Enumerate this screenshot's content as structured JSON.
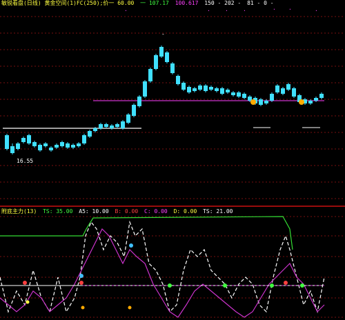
{
  "top_header": {
    "title": "敏锐看盘(日线) 黄金空间(1)FC(250);价一 60.00",
    "items": [
      {
        "text": "一 107.17",
        "color": "#40ff40"
      },
      {
        "text": "100.617",
        "color": "#ff40ff"
      },
      {
        "text": "150 - 202 -",
        "color": "#ffffff"
      },
      {
        "text": "81 - 0 -",
        "color": "#ffffff"
      }
    ]
  },
  "top_chart": {
    "low_label": "16.55",
    "high_label": "-",
    "resistance_color": "#cc33cc",
    "up_color": "#ff3030",
    "down_color": "#40e0ff",
    "baseline_color": "#ffffff"
  },
  "bottom_header": {
    "title": "附底主力(13)",
    "items": [
      {
        "text": "TS: 35.00",
        "color": "#40ff40"
      },
      {
        "text": "A5: 10.00",
        "color": "#ffffff"
      },
      {
        "text": "B: 0.00",
        "color": "#ff4040"
      },
      {
        "text": "C: 0.00",
        "color": "#ff40ff"
      },
      {
        "text": "D: 0.00",
        "color": "#ffff40"
      },
      {
        "text": "TS: 21.00",
        "color": "#ffffff"
      }
    ]
  },
  "colors": {
    "background": "#000000",
    "panel_divider": "#cc1111",
    "grid": "#7a1010",
    "line_green": "#33dd33",
    "line_white": "#ffffff",
    "line_magenta": "#cc33cc"
  }
}
